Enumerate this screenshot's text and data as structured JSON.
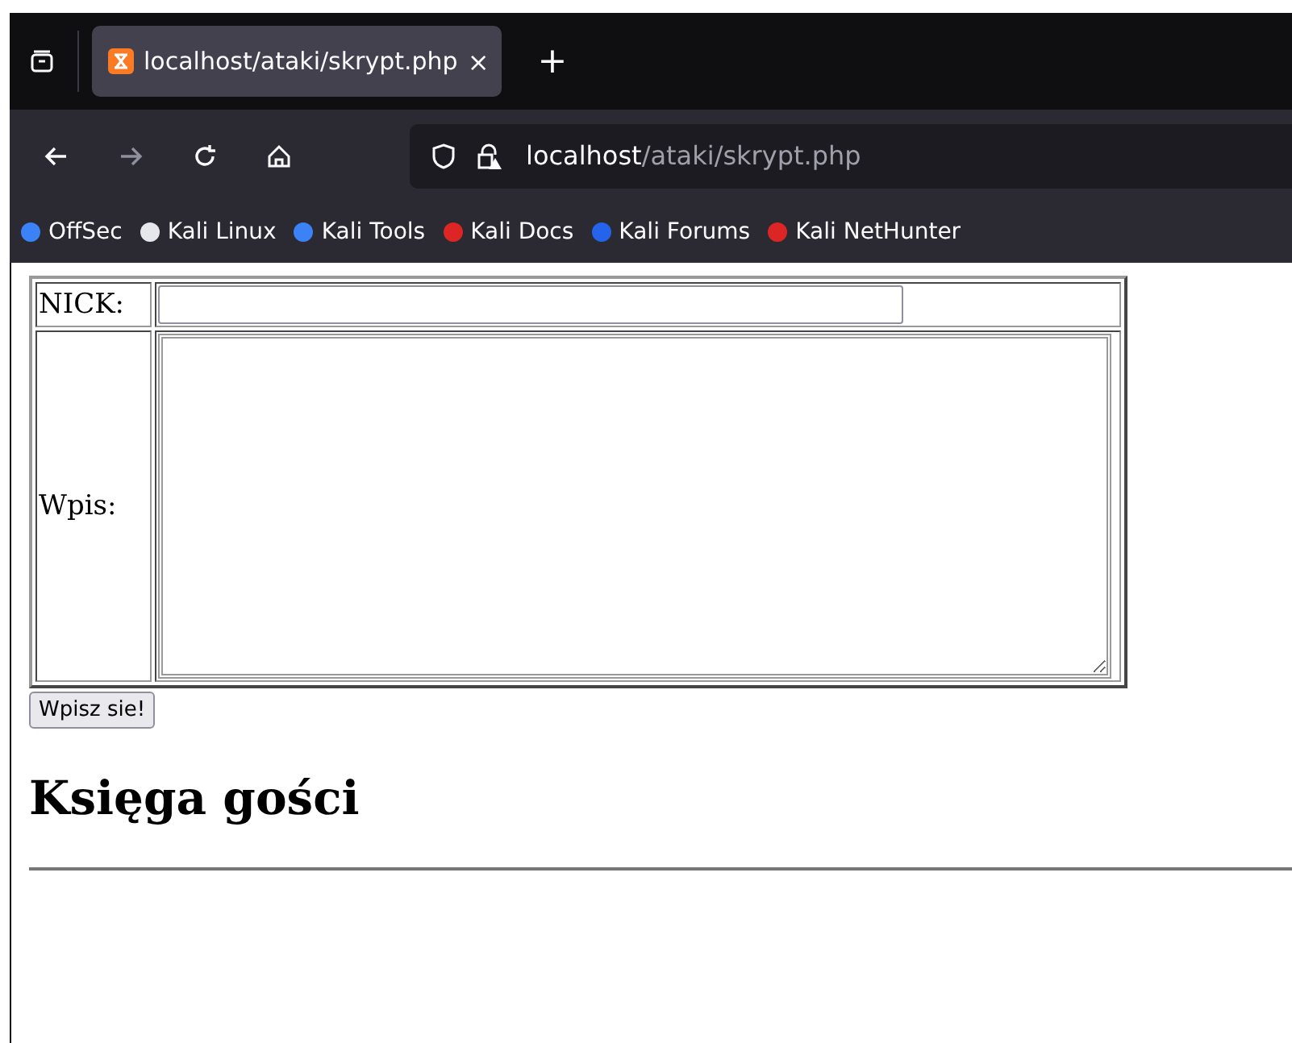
{
  "tabs": [
    {
      "label": "localhost/ataki/skrypt.php",
      "close": "×",
      "selected": true
    }
  ],
  "new_tab": "+",
  "address": {
    "host": "localhost",
    "path": "/ataki/skrypt.php"
  },
  "bookmarks": [
    "OffSec",
    "Kali Linux",
    "Kali Tools",
    "Kali Docs",
    "Kali Forums",
    "Kali NetHunter"
  ],
  "form": {
    "nick_label": "NICK:",
    "entry_label": "Wpis:",
    "submit": "Wpisz sie!"
  },
  "heading": "Księga gości"
}
